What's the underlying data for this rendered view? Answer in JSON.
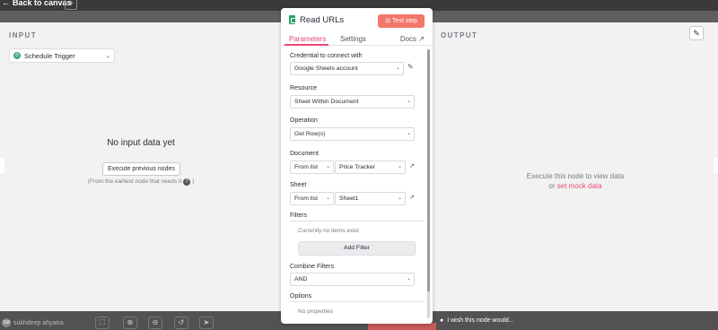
{
  "topbar": {
    "back_label": "Back to canvas",
    "add_label": "+"
  },
  "input_panel": {
    "label": "INPUT",
    "trigger_select": "Schedule Trigger",
    "empty_title": "No input data yet",
    "execute_prev_button": "Execute previous nodes",
    "hint": "(From the earliest node that needs it",
    "hint_close": ")",
    "help_icon": "?"
  },
  "output_panel": {
    "label": "OUTPUT",
    "message": "Execute this node to view data",
    "or_text": "or",
    "mock_link": "set mock data"
  },
  "node": {
    "title": "Read URLs",
    "test_button": "Test step",
    "tabs": [
      {
        "label": "Parameters",
        "active": true
      },
      {
        "label": "Settings",
        "active": false
      }
    ],
    "docs_label": "Docs",
    "fields": {
      "credential_label": "Credential to connect with",
      "credential_value": "Google Sheets account",
      "resource_label": "Resource",
      "resource_value": "Sheet Within Document",
      "operation_label": "Operation",
      "operation_value": "Get Row(s)",
      "document_label": "Document",
      "document_mode": "From list",
      "document_value": "Price Tracker",
      "sheet_label": "Sheet",
      "sheet_mode": "From list",
      "sheet_value": "Sheet1",
      "filters_label": "Filters",
      "filters_empty": "Currently no items exist",
      "add_filter_button": "Add Filter",
      "combine_label": "Combine Filters",
      "combine_value": "AND",
      "options_label": "Options",
      "options_empty": "No properties"
    }
  },
  "bottombar": {
    "user_initials": "SM",
    "user_name": "sukhdeep ahyatra",
    "wish_text": "I wish this node would..."
  },
  "colors": {
    "accent": "#ea4b71",
    "test_button": "#f2776a",
    "sheets_green": "#1fa463",
    "trigger_green": "#3da877"
  },
  "icons": [
    "arrow-left-icon",
    "plus-icon",
    "schedule-trigger-icon",
    "chevron-down-icon",
    "google-sheets-icon",
    "flask-icon",
    "external-link-icon",
    "pencil-icon",
    "help-icon",
    "fit-view-icon",
    "zoom-in-icon",
    "zoom-out-icon",
    "undo-icon",
    "pointer-icon",
    "lightbulb-icon"
  ]
}
